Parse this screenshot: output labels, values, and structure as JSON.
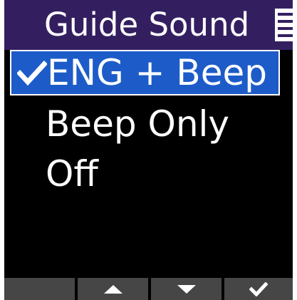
{
  "header": {
    "title": "Guide Sound"
  },
  "menu": {
    "selected_index": 0,
    "items": [
      {
        "label": "ENG + Beep",
        "checked": true
      },
      {
        "label": "Beep Only",
        "checked": false
      },
      {
        "label": "Off",
        "checked": false
      }
    ]
  },
  "footer": {
    "keys": [
      {
        "icon": "blank"
      },
      {
        "icon": "up-arrow-icon"
      },
      {
        "icon": "down-arrow-icon"
      },
      {
        "icon": "enter-check-icon"
      }
    ]
  },
  "colors": {
    "header_bg": "#331f60",
    "selection_bg": "#1d5cc8",
    "screen_bg": "#000000",
    "footer_key_bg": "#464646",
    "text": "#ffffff"
  }
}
